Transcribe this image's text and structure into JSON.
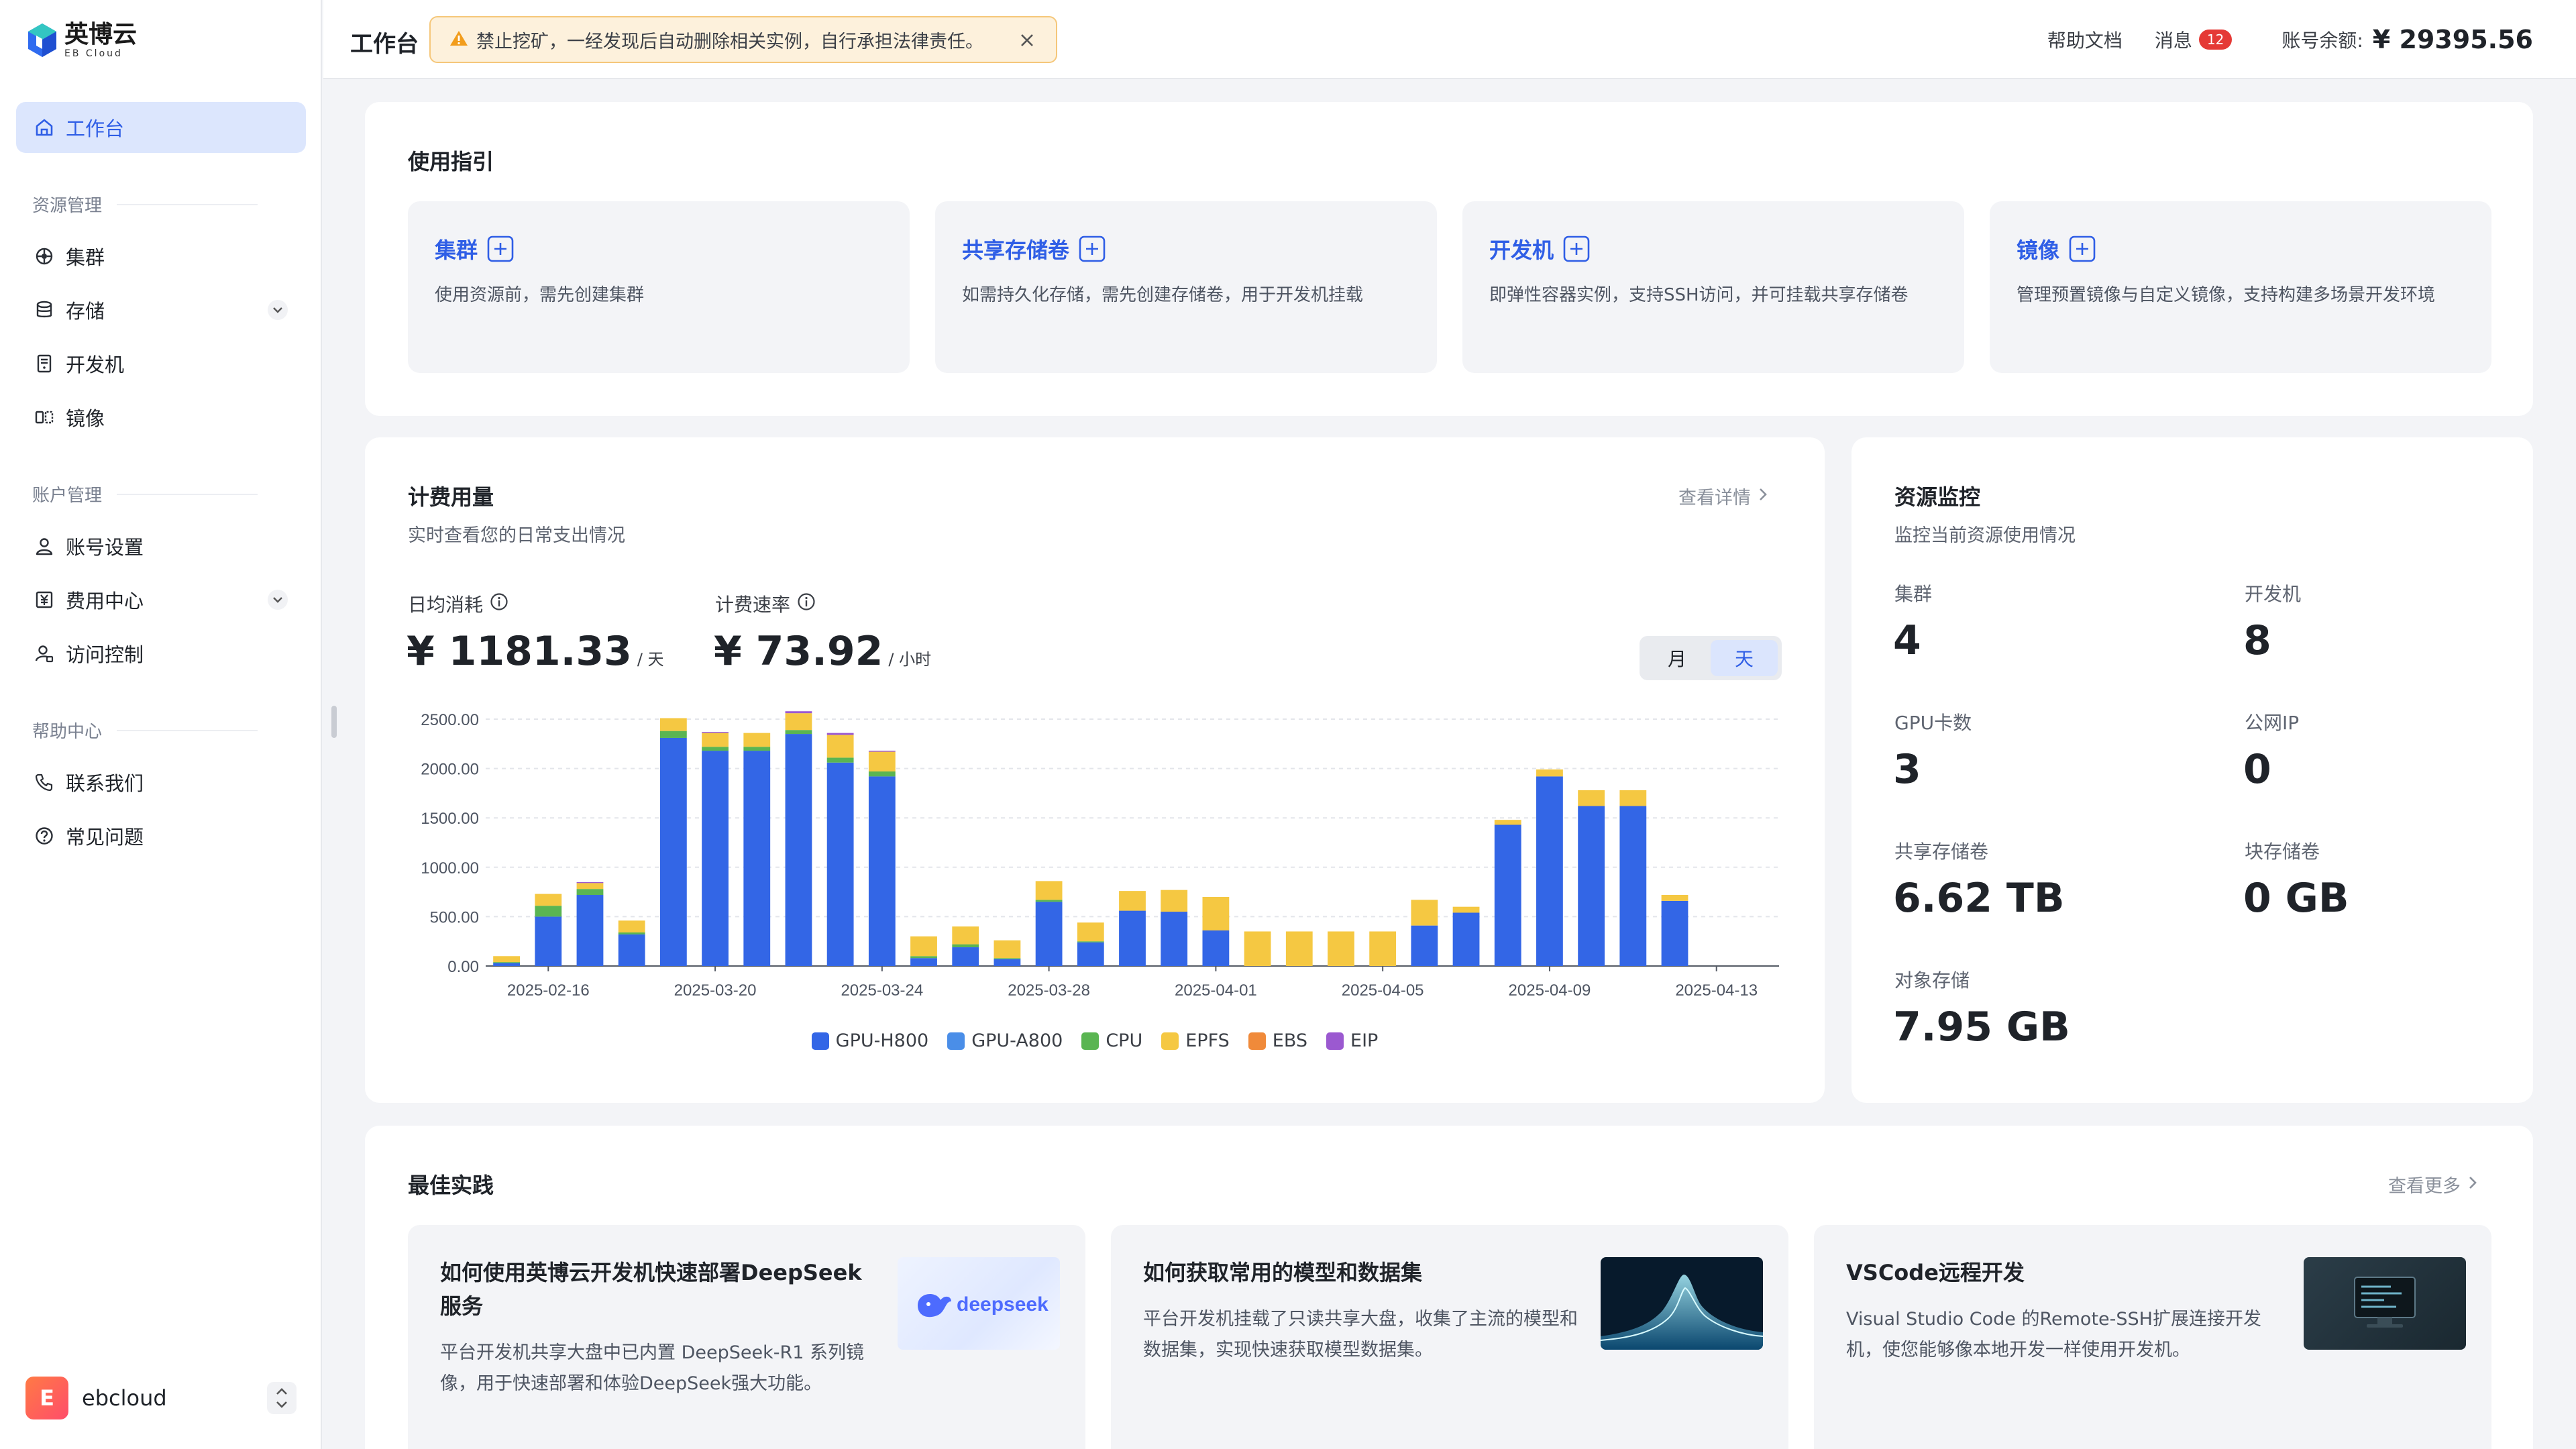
{
  "brand": {
    "name_cn": "英博云",
    "name_en": "EB Cloud"
  },
  "sidebar": {
    "active_item": "工作台",
    "sections": [
      {
        "title": "资源管理",
        "items": [
          "集群",
          "存储",
          "开发机",
          "镜像"
        ]
      },
      {
        "title": "账户管理",
        "items": [
          "账号设置",
          "费用中心",
          "访问控制"
        ]
      },
      {
        "title": "帮助中心",
        "items": [
          "联系我们",
          "常见问题"
        ]
      }
    ],
    "user": {
      "avatar_letter": "E",
      "name": "ebcloud"
    }
  },
  "topbar": {
    "title": "工作台",
    "notice": "禁止挖矿，一经发现后自动删除相关实例，自行承担法律责任。",
    "help": "帮助文档",
    "messages": "消息",
    "message_count": "12",
    "balance_label": "账号余额:",
    "balance": "¥ 29395.56"
  },
  "guide": {
    "title": "使用指引",
    "tiles": [
      {
        "title": "集群",
        "desc": "使用资源前，需先创建集群"
      },
      {
        "title": "共享存储卷",
        "desc": "如需持久化存储，需先创建存储卷，用于开发机挂载"
      },
      {
        "title": "开发机",
        "desc": "即弹性容器实例，支持SSH访问，并可挂载共享存储卷"
      },
      {
        "title": "镜像",
        "desc": "管理预置镜像与自定义镜像，支持构建多场景开发环境"
      }
    ]
  },
  "billing": {
    "title": "计费用量",
    "subtitle": "实时查看您的日常支出情况",
    "more": "查看详情",
    "daily_label": "日均消耗",
    "daily_value": "¥ 1181.33",
    "daily_unit": "/ 天",
    "rate_label": "计费速率",
    "rate_value": "¥ 73.92",
    "rate_unit": "/ 小时",
    "toggle": [
      "月",
      "天"
    ],
    "toggle_active": "天"
  },
  "monitor": {
    "title": "资源监控",
    "subtitle": "监控当前资源使用情况",
    "items": [
      {
        "label": "集群",
        "value": "4"
      },
      {
        "label": "开发机",
        "value": "8"
      },
      {
        "label": "GPU卡数",
        "value": "3"
      },
      {
        "label": "公网IP",
        "value": "0"
      },
      {
        "label": "共享存储卷",
        "value": "6.62 TB"
      },
      {
        "label": "块存储卷",
        "value": "0 GB"
      },
      {
        "label": "对象存储",
        "value": "7.95 GB"
      }
    ]
  },
  "practices": {
    "title": "最佳实践",
    "more": "查看更多",
    "items": [
      {
        "title": "如何使用英博云开发机快速部署DeepSeek服务",
        "desc": "平台开发机共享大盘中已内置 DeepSeek-R1 系列镜像，用于快速部署和体验DeepSeek强大功能。",
        "image_text": "deepseek"
      },
      {
        "title": "如何获取常用的模型和数据集",
        "desc": "平台开发机挂载了只读共享大盘，收集了主流的模型和数据集，实现快速获取模型数据集。"
      },
      {
        "title": "VSCode远程开发",
        "desc": "Visual Studio Code 的Remote-SSH扩展连接开发机，使您能够像本地开发一样使用开发机。"
      }
    ]
  },
  "colors": {
    "accent": "#2f5ee6",
    "gpu_h800": "#3366e6",
    "gpu_a800": "#4a8ee8",
    "cpu": "#5ab552",
    "epfs": "#f5c842",
    "ebs": "#f08a3a",
    "eip": "#9b59d0"
  },
  "chart_data": {
    "type": "bar",
    "stacked": true,
    "y_ticks": [
      "0.00",
      "500.00",
      "1000.00",
      "1500.00",
      "2000.00",
      "2500.00"
    ],
    "ylim": [
      0,
      2500
    ],
    "x_tick_labels": [
      "2025-02-16",
      "2025-03-20",
      "2025-03-24",
      "2025-03-28",
      "2025-04-01",
      "2025-04-05",
      "2025-04-09",
      "2025-04-13"
    ],
    "x_tick_positions": [
      1,
      5,
      9,
      13,
      17,
      21,
      25,
      29
    ],
    "bar_count": 31,
    "series": [
      {
        "name": "GPU-H800",
        "values": [
          30,
          500,
          720,
          320,
          2310,
          2180,
          2180,
          2350,
          2060,
          1920,
          80,
          190,
          70,
          650,
          240,
          560,
          550,
          360,
          0,
          0,
          0,
          0,
          410,
          540,
          1430,
          1920,
          1620,
          1620,
          660
        ]
      },
      {
        "name": "GPU-A800",
        "values": [
          0,
          0,
          0,
          0,
          0,
          0,
          0,
          0,
          0,
          0,
          0,
          0,
          0,
          0,
          0,
          0,
          0,
          0,
          0,
          0,
          0,
          0,
          0,
          0,
          0,
          0,
          0,
          0,
          0
        ]
      },
      {
        "name": "CPU",
        "values": [
          10,
          110,
          60,
          20,
          70,
          40,
          40,
          40,
          50,
          50,
          20,
          30,
          10,
          20,
          10,
          0,
          0,
          0,
          0,
          0,
          0,
          0,
          0,
          0,
          0,
          0,
          0,
          0,
          0
        ]
      },
      {
        "name": "EPFS",
        "values": [
          60,
          120,
          60,
          120,
          130,
          140,
          140,
          170,
          230,
          200,
          200,
          180,
          180,
          190,
          190,
          200,
          220,
          340,
          350,
          350,
          350,
          350,
          260,
          60,
          50,
          70,
          160,
          160,
          60
        ]
      },
      {
        "name": "EBS",
        "values": [
          0,
          0,
          0,
          0,
          0,
          0,
          0,
          0,
          0,
          0,
          0,
          0,
          0,
          0,
          0,
          0,
          0,
          0,
          0,
          0,
          0,
          0,
          0,
          0,
          0,
          0,
          0,
          0,
          0
        ]
      },
      {
        "name": "EIP",
        "values": [
          0,
          0,
          10,
          0,
          0,
          10,
          0,
          20,
          20,
          10,
          0,
          0,
          0,
          0,
          0,
          0,
          0,
          0,
          0,
          0,
          0,
          0,
          0,
          0,
          0,
          0,
          0,
          0,
          0
        ]
      }
    ],
    "bar_slots": [
      0,
      1,
      2,
      3,
      4,
      5,
      6,
      7,
      8,
      9,
      10,
      11,
      12,
      13,
      14,
      15,
      16,
      17,
      18,
      19,
      20,
      21,
      22,
      23,
      24,
      25,
      26,
      27,
      28
    ]
  }
}
